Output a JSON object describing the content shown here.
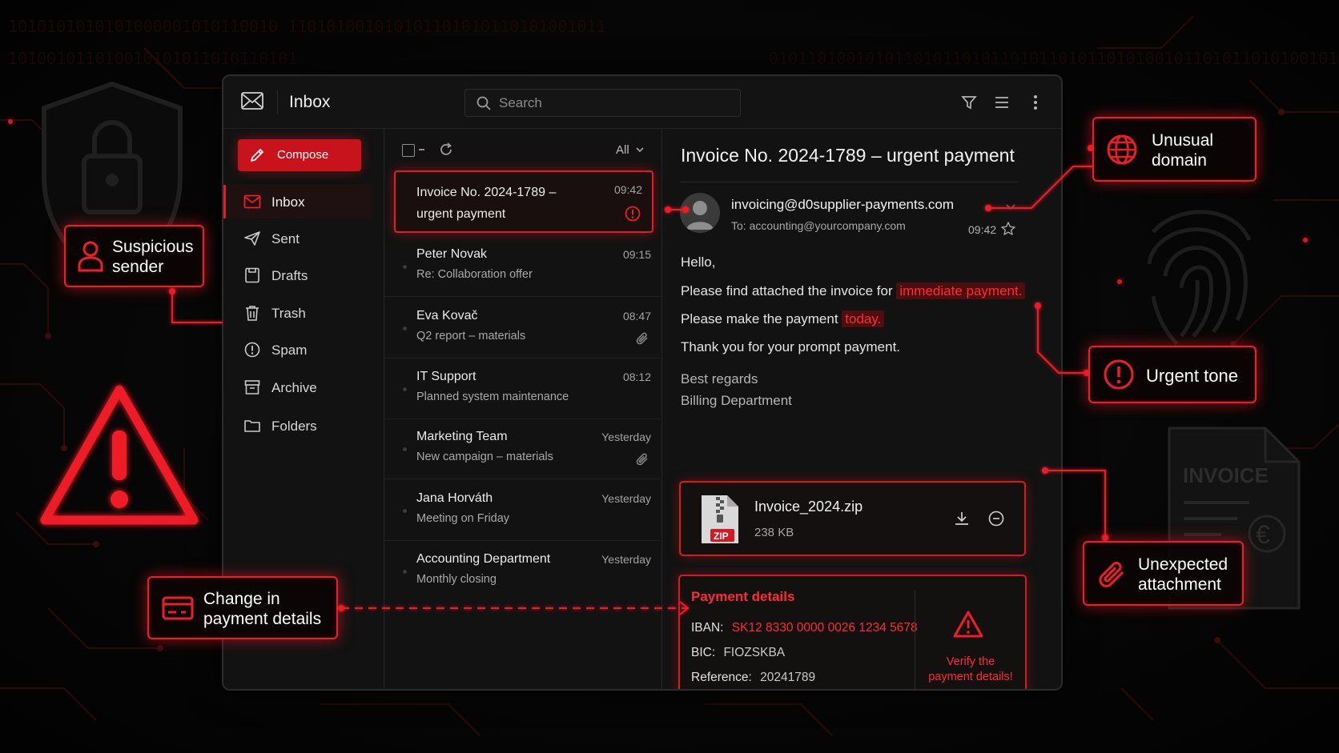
{
  "background_code": [
    "1010101010101000001010110010 110101001010101101010110101001011",
    "101001011010010101011010110101",
    "01011010010101101011010110101101011010100101101011010100101"
  ],
  "window": {
    "title": "Inbox",
    "search_placeholder": "Search"
  },
  "sidebar": {
    "compose_label": "Compose",
    "items": [
      {
        "label": "Inbox",
        "icon": "mail-icon",
        "active": true
      },
      {
        "label": "Sent",
        "icon": "send-icon"
      },
      {
        "label": "Drafts",
        "icon": "drafts-icon"
      },
      {
        "label": "Trash",
        "icon": "trash-icon"
      },
      {
        "label": "Spam",
        "icon": "spam-icon"
      },
      {
        "label": "Archive",
        "icon": "archive-icon"
      },
      {
        "label": "Folders",
        "icon": "folder-icon"
      }
    ]
  },
  "list": {
    "filter_label": "All",
    "messages": [
      {
        "sender": "Invoice No. 2024-1789 – urgent payment",
        "subject": "",
        "time": "09:42",
        "selected": true,
        "flag": "warning"
      },
      {
        "sender": "Peter Novak",
        "subject": "Re: Collaboration offer",
        "time": "09:15"
      },
      {
        "sender": "Eva Kovač",
        "subject": "Q2 report – materials",
        "time": "08:47",
        "attachment": true
      },
      {
        "sender": "IT Support",
        "subject": "Planned system maintenance",
        "time": "08:12"
      },
      {
        "sender": "Marketing Team",
        "subject": "New campaign – materials",
        "time": "Yesterday",
        "attachment": true
      },
      {
        "sender": "Jana Horváth",
        "subject": "Meeting on Friday",
        "time": "Yesterday"
      },
      {
        "sender": "Accounting Department",
        "subject": "Monthly closing",
        "time": "Yesterday"
      }
    ]
  },
  "email": {
    "subject": "Invoice No. 2024-1789 – urgent payment",
    "from": "invoicing@d0supplier-payments.com",
    "to": "To: accounting@yourcompany.com",
    "time": "09:42",
    "greeting": "Hello,",
    "line1_pre": "Please find attached the invoice for",
    "line1_hl": "immediate payment.",
    "line2_pre": "Please make the payment",
    "line2_hl": "today.",
    "line3": "Thank you for your prompt payment.",
    "regards": "Best regards",
    "signature": "Billing Department",
    "attachment": {
      "name": "Invoice_2024.zip",
      "size": "238 KB",
      "badge": "ZIP"
    },
    "payment": {
      "title": "Payment details",
      "iban_label": "IBAN:",
      "iban": "SK12 8330 0000 0026 1234 5678",
      "bic_label": "BIC:",
      "bic": "FIOZSKBA",
      "ref_label": "Reference:",
      "ref": "20241789",
      "verify_line1": "Verify the",
      "verify_line2": "payment details!"
    }
  },
  "callouts": {
    "suspicious_sender": [
      "Suspicious",
      "sender"
    ],
    "unusual_domain": [
      "Unusual",
      "domain"
    ],
    "urgent_tone": "Urgent tone",
    "unexpected_attachment": [
      "Unexpected",
      "attachment"
    ],
    "change_payment": [
      "Change in",
      "payment details"
    ]
  },
  "decor": {
    "invoice_doc_label": "INVOICE",
    "currency_symbol": "€"
  },
  "colors": {
    "accent": "#e51b24",
    "alert_text": "#ff2a32",
    "background": "#050505",
    "panel": "#121212"
  }
}
